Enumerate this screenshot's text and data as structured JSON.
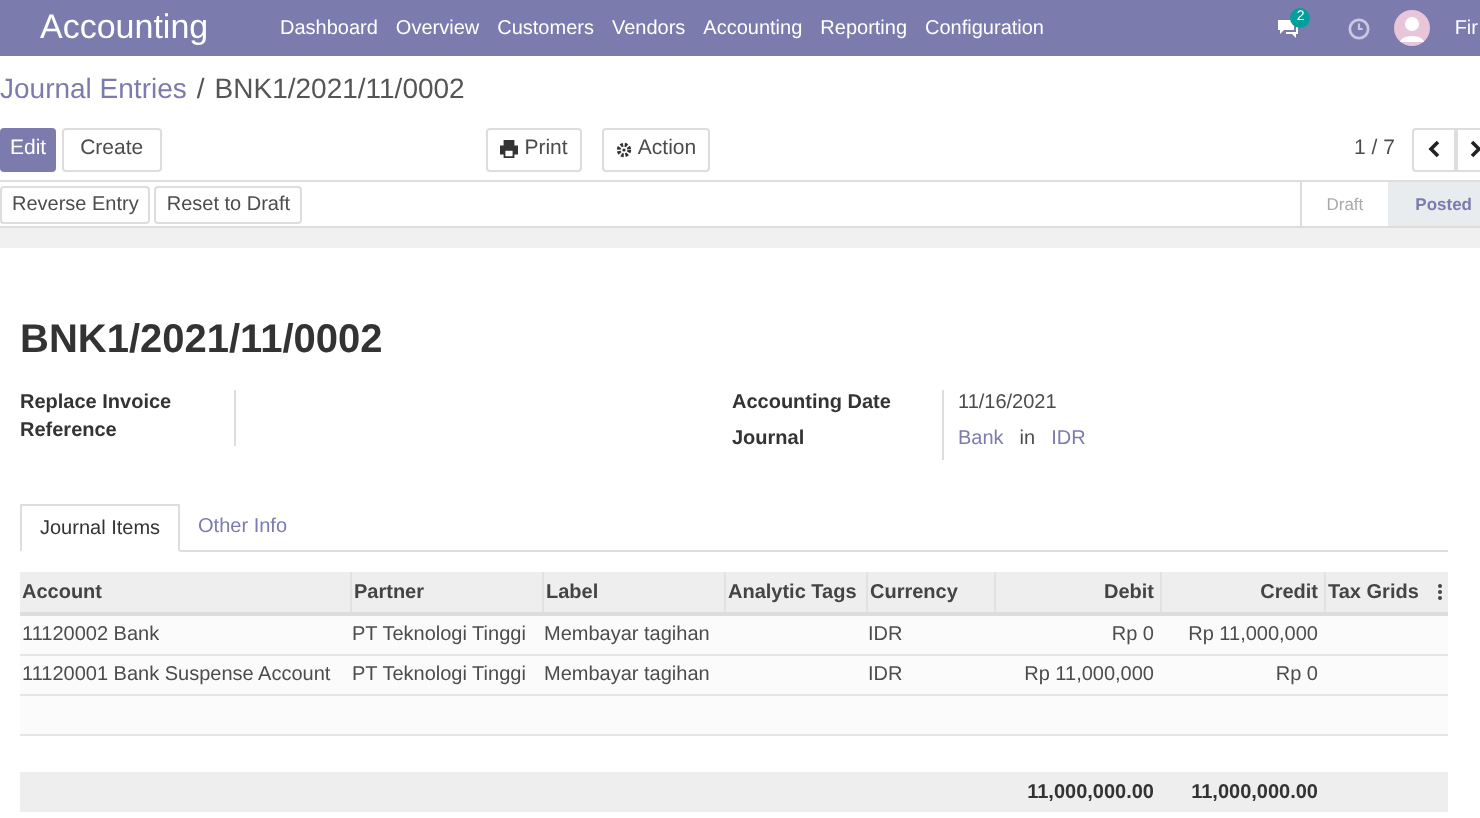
{
  "navbar": {
    "app_name": "Accounting",
    "menu": [
      "Dashboard",
      "Overview",
      "Customers",
      "Vendors",
      "Accounting",
      "Reporting",
      "Configuration"
    ],
    "message_count": "2",
    "user": "Fir"
  },
  "breadcrumb": {
    "parent": "Journal Entries",
    "separator": "/",
    "current": "BNK1/2021/11/0002"
  },
  "control_buttons": {
    "edit": "Edit",
    "create": "Create",
    "print": "Print",
    "action": "Action",
    "pager": "1 / 7"
  },
  "header_buttons": [
    "Reverse Entry",
    "Reset to Draft"
  ],
  "statusbar": [
    {
      "label": "Draft",
      "selected": false
    },
    {
      "label": "Posted",
      "selected": true
    }
  ],
  "form": {
    "title": "BNK1/2021/11/0002",
    "replace_label": "Replace Invoice Reference",
    "date_label": "Accounting Date",
    "date_value": "11/16/2021",
    "journal_label": "Journal",
    "journal": "Bank",
    "journal_in": "in",
    "journal_currency": "IDR"
  },
  "tabs": [
    {
      "label": "Journal Items",
      "selected": true
    },
    {
      "label": "Other Info",
      "selected": false
    }
  ],
  "table": {
    "columns": [
      "Account",
      "Partner",
      "Label",
      "Analytic Tags",
      "Currency",
      "Debit",
      "Credit",
      "Tax Grids"
    ],
    "rows": [
      [
        "11120002 Bank",
        "PT Teknologi Tinggi",
        "Membayar tagihan",
        "",
        "IDR",
        "Rp 0",
        "Rp 11,000,000",
        ""
      ],
      [
        "11120001 Bank Suspense Account",
        "PT Teknologi Tinggi",
        "Membayar tagihan",
        "",
        "IDR",
        "Rp 11,000,000",
        "Rp 0",
        ""
      ]
    ],
    "totals": {
      "debit": "11,000,000.00",
      "credit": "11,000,000.00"
    }
  }
}
